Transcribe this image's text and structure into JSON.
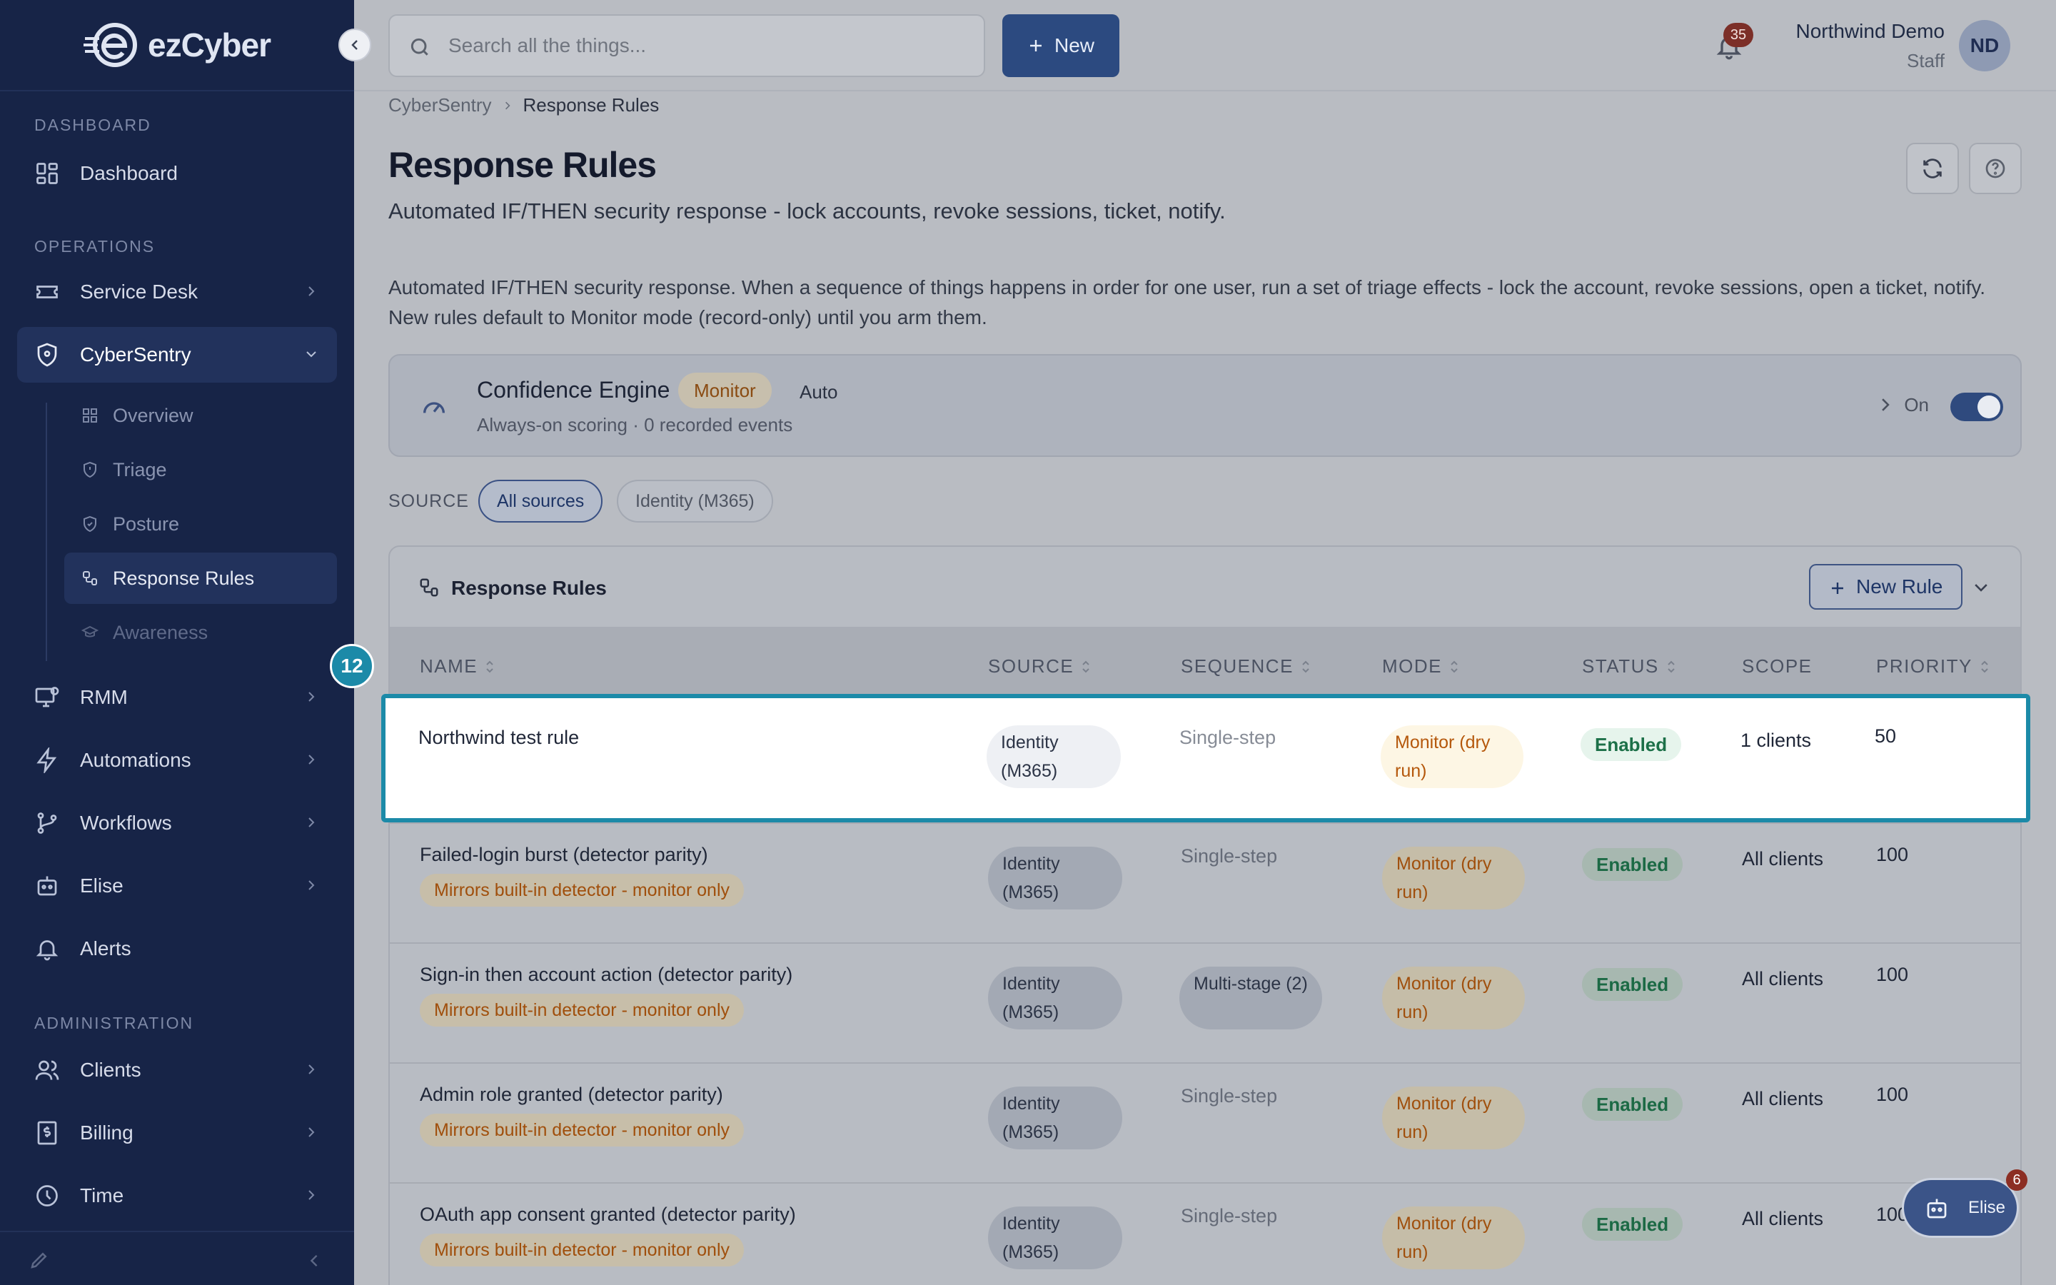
{
  "app": {
    "brand": "ezCyber",
    "accent": "#2c4a80",
    "sidebar_bg": "#172447",
    "highlight": "#1c8aa8"
  },
  "sidebar": {
    "sections": {
      "dashboard": "DASHBOARD",
      "operations": "OPERATIONS",
      "administration": "ADMINISTRATION"
    },
    "items": {
      "dashboard": "Dashboard",
      "service_desk": "Service Desk",
      "cybersentry": "CyberSentry",
      "rmm": "RMM",
      "automations": "Automations",
      "workflows": "Workflows",
      "elise": "Elise",
      "alerts": "Alerts",
      "clients": "Clients",
      "billing": "Billing",
      "time": "Time"
    },
    "sub_items": {
      "overview": "Overview",
      "triage": "Triage",
      "posture": "Posture",
      "response_rules": "Response Rules",
      "awareness": "Awareness"
    }
  },
  "topbar": {
    "search_placeholder": "Search all the things...",
    "new_label": "New",
    "notifications_count": "35",
    "user_name": "Northwind Demo",
    "user_role": "Staff",
    "user_initials": "ND"
  },
  "breadcrumb": {
    "parent": "CyberSentry",
    "current": "Response Rules"
  },
  "page": {
    "title": "Response Rules",
    "subtitle": "Automated IF/THEN security response - lock accounts, revoke sessions, ticket, notify.",
    "description": "Automated IF/THEN security response. When a sequence of things happens in order for one user, run a set of triage effects - lock the account, revoke sessions, open a ticket, notify. New rules default to Monitor mode (record-only) until you arm them."
  },
  "engine": {
    "title": "Confidence Engine",
    "mode_badge": "Monitor",
    "auto_label": "Auto",
    "meta": "Always-on scoring · 0 recorded events",
    "toggle_label": "On",
    "enabled": true
  },
  "filters": {
    "label": "SOURCE",
    "options": [
      "All sources",
      "Identity (M365)"
    ],
    "selected": "All sources"
  },
  "rules_card": {
    "title": "Response Rules",
    "new_rule_label": "New Rule",
    "columns": {
      "name": "NAME",
      "source": "SOURCE",
      "sequence": "SEQUENCE",
      "mode": "MODE",
      "status": "STATUS",
      "scope": "SCOPE",
      "priority": "PRIORITY"
    },
    "rows": [
      {
        "name": "Northwind test rule",
        "badge": "",
        "source": "Identity (M365)",
        "sequence": "Single-step",
        "mode": "Monitor (dry run)",
        "status": "Enabled",
        "scope": "1 clients",
        "priority": "50"
      },
      {
        "name": "Failed-login burst (detector parity)",
        "badge": "Mirrors built-in detector - monitor only",
        "source": "Identity (M365)",
        "sequence": "Single-step",
        "mode": "Monitor (dry run)",
        "status": "Enabled",
        "scope": "All clients",
        "priority": "100"
      },
      {
        "name": "Sign-in then account action (detector parity)",
        "badge": "Mirrors built-in detector - monitor only",
        "source": "Identity (M365)",
        "sequence": "Multi-stage (2)",
        "mode": "Monitor (dry run)",
        "status": "Enabled",
        "scope": "All clients",
        "priority": "100"
      },
      {
        "name": "Admin role granted (detector parity)",
        "badge": "Mirrors built-in detector - monitor only",
        "source": "Identity (M365)",
        "sequence": "Single-step",
        "mode": "Monitor (dry run)",
        "status": "Enabled",
        "scope": "All clients",
        "priority": "100"
      },
      {
        "name": "OAuth app consent granted (detector parity)",
        "badge": "Mirrors built-in detector - monitor only",
        "source": "Identity (M365)",
        "sequence": "Single-step",
        "mode": "Monitor (dry run)",
        "status": "Enabled",
        "scope": "All clients",
        "priority": "100"
      }
    ]
  },
  "annotation": {
    "step_number": "12"
  },
  "elise_widget": {
    "label": "Elise",
    "badge": "6"
  }
}
